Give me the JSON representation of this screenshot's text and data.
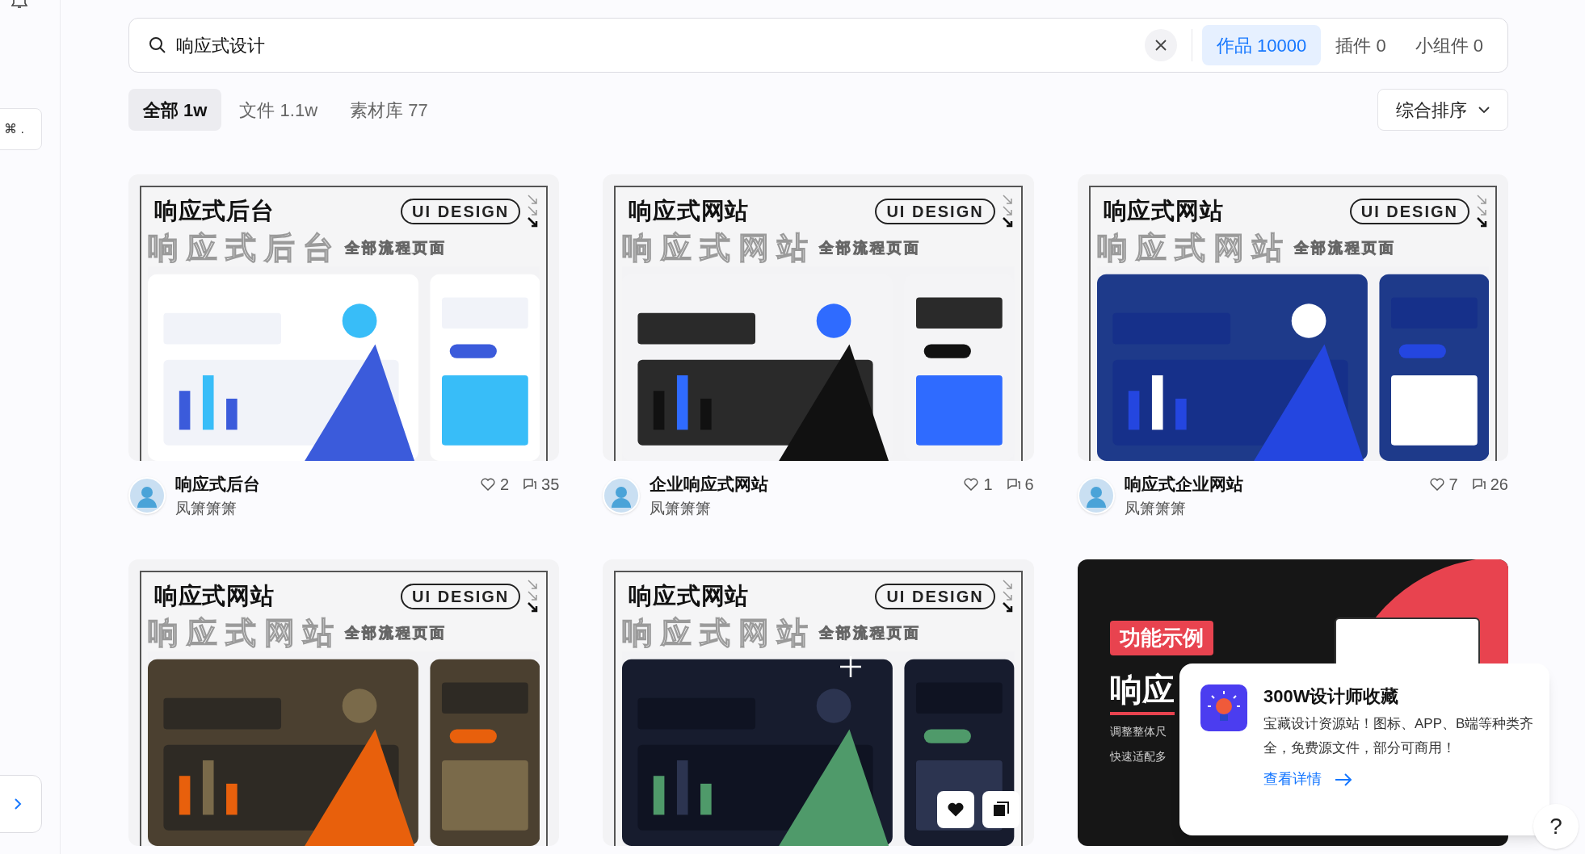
{
  "sidebar": {
    "shortcut": "⌘ ."
  },
  "search": {
    "value": "响应式设计",
    "chips": [
      {
        "label": "作品",
        "count": "10000",
        "selected": true
      },
      {
        "label": "插件",
        "count": "0",
        "selected": false
      },
      {
        "label": "小组件",
        "count": "0",
        "selected": false
      }
    ]
  },
  "tabs": [
    {
      "label": "全部",
      "count": "1w",
      "selected": true
    },
    {
      "label": "文件",
      "count": "1.1w",
      "selected": false
    },
    {
      "label": "素材库",
      "count": "77",
      "selected": false
    }
  ],
  "sort": {
    "label": "综合排序"
  },
  "cards": [
    {
      "cover": {
        "kind": "poster",
        "title": "响应式后台",
        "badge": "UI DESIGN",
        "watermark": "响应式后台",
        "subtitle": "全部流程页面"
      },
      "title": "响应式后台",
      "author": "凤箫箫箫",
      "likes": "2",
      "comments": "35"
    },
    {
      "cover": {
        "kind": "poster",
        "title": "响应式网站",
        "badge": "UI DESIGN",
        "watermark": "响应式网站",
        "subtitle": "全部流程页面"
      },
      "title": "企业响应式网站",
      "author": "凤箫箫箫",
      "likes": "1",
      "comments": "6"
    },
    {
      "cover": {
        "kind": "poster",
        "title": "响应式网站",
        "badge": "UI DESIGN",
        "watermark": "响应式网站",
        "subtitle": "全部流程页面"
      },
      "title": "响应式企业网站",
      "author": "凤箫箫箫",
      "likes": "7",
      "comments": "26"
    },
    {
      "cover": {
        "kind": "poster",
        "title": "响应式网站",
        "badge": "UI DESIGN",
        "watermark": "响应式网站",
        "subtitle": "全部流程页面"
      }
    },
    {
      "cover": {
        "kind": "poster",
        "title": "响应式网站",
        "badge": "UI DESIGN",
        "watermark": "响应式网站",
        "subtitle": "全部流程页面"
      },
      "hover": true
    },
    {
      "cover": {
        "kind": "feature",
        "tag": "功能示例",
        "title": "响应",
        "lines": [
          "调整整体尺",
          "快速适配多"
        ]
      }
    }
  ],
  "popup": {
    "title": "300W设计师收藏",
    "text": "宝藏设计资源站！图标、APP、B端等种类齐全，免费源文件，部分可商用！",
    "link": "查看详情"
  },
  "help": "?"
}
